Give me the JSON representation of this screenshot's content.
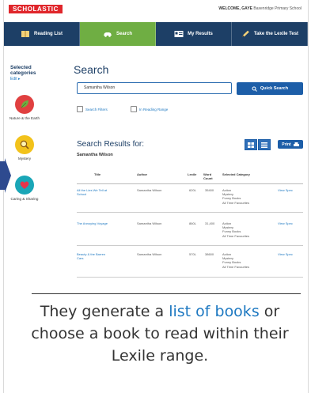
{
  "header": {
    "logo": "SCHOLASTIC",
    "welcome_prefix": "WELCOME, GAYE",
    "welcome_suffix": "Baxenridge Primary School"
  },
  "nav": {
    "tabs": [
      {
        "label": "Reading List",
        "icon": "book-icon"
      },
      {
        "label": "Search",
        "icon": "car-icon"
      },
      {
        "label": "My Results",
        "icon": "id-card-icon"
      },
      {
        "label": "Take the Lexile Test",
        "icon": "pencil-icon"
      }
    ],
    "active_color": "#6fae43",
    "base_color": "#1d3f66"
  },
  "sidebar": {
    "title": "Selected categories",
    "edit": "Edit ▸",
    "categories": [
      {
        "label": "Nature & the Earth",
        "icon": "leaf-icon",
        "color": "#e04040"
      },
      {
        "label": "Mystery",
        "icon": "magnifier-icon",
        "color": "#f2c21b"
      },
      {
        "label": "Caring & Sharing",
        "icon": "heart-icon",
        "color": "#1aa6b7"
      }
    ]
  },
  "search": {
    "title": "Search",
    "value": "Samantha Wilson",
    "button": "Quick Search",
    "options": [
      "Search Filters",
      "In Reading Range"
    ]
  },
  "results": {
    "title": "Search Results for:",
    "query": "Samantha Wilson",
    "print": "Print",
    "columns": [
      "Title",
      "Author",
      "Lexile",
      "Word Count",
      "Selected Category"
    ],
    "rows": [
      {
        "title": "All the Lies We Tell at School",
        "author": "Samantha Wilson",
        "lexile": "620L",
        "words": "35400",
        "categories": "Action\nMystery\nFunny Books\nAll Time Favourites",
        "link": "View Spec"
      },
      {
        "title": "The Annoying Voyage",
        "author": "Samantha Wilson",
        "lexile": "860L",
        "words": "31,400",
        "categories": "Action\nMystery\nFunny Books\nAll Time Favourites",
        "link": "View Spec"
      },
      {
        "title": "Beauty & the Barren Cars",
        "author": "Samantha Wilson",
        "lexile": "570L",
        "words": "38600",
        "categories": "Action\nMystery\nFunny Books\nAll Time Favourites",
        "link": "View Spec"
      }
    ]
  },
  "caption": {
    "before": "They generate a ",
    "highlight": "list of books",
    "after": " or choose a book to read within their Lexile range."
  }
}
